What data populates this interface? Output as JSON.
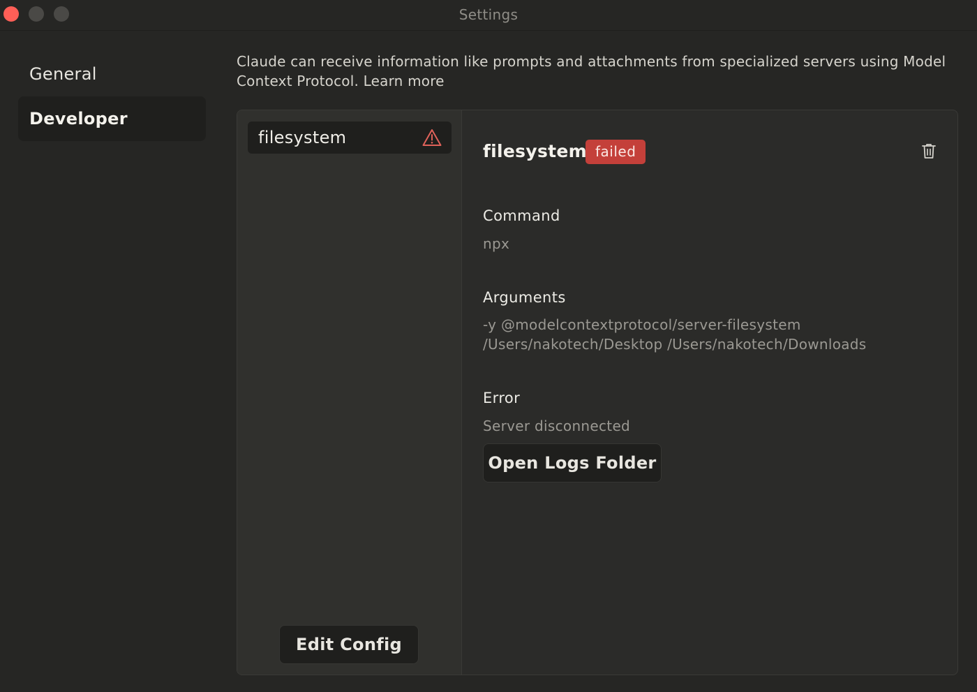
{
  "window": {
    "title": "Settings",
    "controls": [
      "close",
      "minimize",
      "maximize"
    ]
  },
  "nav": {
    "items": [
      {
        "label": "General",
        "active": false
      },
      {
        "label": "Developer",
        "active": true
      }
    ]
  },
  "intro": {
    "text": "Claude can receive information like prompts and attachments from specialized servers using Model Context Protocol. Learn more"
  },
  "servers": [
    {
      "name": "filesystem",
      "status_icon": "warning-icon"
    }
  ],
  "edit_config_label": "Edit Config",
  "detail": {
    "name": "filesystem",
    "status": "failed",
    "delete_icon": "trash-icon",
    "command_label": "Command",
    "command_value": "npx",
    "arguments_label": "Arguments",
    "arguments_value": "-y @modelcontextprotocol/server-filesystem /Users/nakotech/Desktop /Users/nakotech/Downloads",
    "error_label": "Error",
    "error_value": "Server disconnected",
    "open_logs_label": "Open Logs Folder"
  },
  "colors": {
    "background": "#262624",
    "panel": "#2b2b29",
    "failed_badge": "#c4403a",
    "warning": "#e0625a",
    "close_button": "#ff5f57"
  }
}
